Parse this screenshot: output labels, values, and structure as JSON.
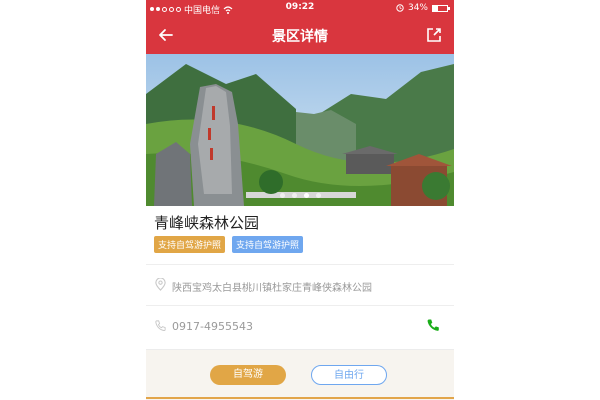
{
  "status": {
    "carrier": "中国电信",
    "time": "09:22",
    "battery": "34%",
    "battery_level": 0.34
  },
  "header": {
    "title": "景区详情",
    "back_icon": "back-arrow-icon",
    "share_icon": "share-icon"
  },
  "gallery": {
    "page_count": 4,
    "active_index": 2
  },
  "scenic": {
    "name": "青峰峡森林公园",
    "badges": [
      {
        "label": "支持自驾游护照",
        "color": "#e1a646"
      },
      {
        "label": "支持自驾游护照",
        "color": "#6fa7ef"
      }
    ],
    "address": "陕西宝鸡太白县桃川镇杜家庄青峰侠森林公园",
    "phone": "0917-4955543"
  },
  "footer": {
    "tabs": [
      {
        "label": "自驾游"
      },
      {
        "label": "自由行"
      }
    ]
  },
  "colors": {
    "brand": "#d9363e",
    "orange": "#e1a646",
    "blue": "#6fa7ef",
    "call_green": "#1aad19"
  }
}
